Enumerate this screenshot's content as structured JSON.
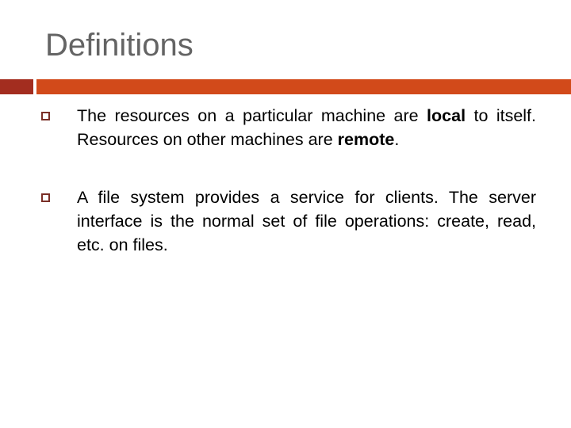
{
  "slide": {
    "title": "Definitions",
    "accent_colors": {
      "bar_dark": "#a32d1f",
      "bar_orange": "#d24a1a",
      "bullet": "#7a2f27"
    },
    "bullets": [
      {
        "icon": "square-bullet-icon",
        "parts": [
          {
            "text": "The resources on a particular machine are ",
            "bold": false
          },
          {
            "text": "local",
            "bold": true
          },
          {
            "text": " to itself.  Resources on other machines are ",
            "bold": false
          },
          {
            "text": "remote",
            "bold": true
          },
          {
            "text": ".",
            "bold": false
          }
        ]
      },
      {
        "icon": "square-bullet-icon",
        "parts": [
          {
            "text": "A file system provides a service for clients. The server interface is the normal set of file operations: create, read, etc. on files.",
            "bold": false
          }
        ]
      }
    ]
  }
}
